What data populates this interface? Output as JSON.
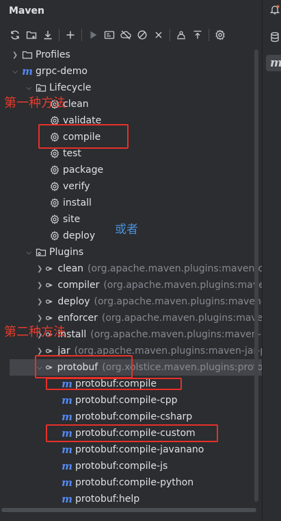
{
  "header": {
    "title": "Maven"
  },
  "toolbar": {
    "buttons": [
      {
        "icon": "refresh-icon"
      },
      {
        "icon": "add-folder-icon"
      },
      {
        "icon": "download-icon"
      },
      {
        "icon": "plus-icon"
      },
      {
        "icon": "run-icon"
      },
      {
        "icon": "execute-goal-icon"
      },
      {
        "icon": "offline-icon"
      },
      {
        "icon": "skip-tests-icon"
      },
      {
        "icon": "collapse-icon"
      },
      {
        "icon": "dependency-icon"
      },
      {
        "icon": "expand-all-icon"
      },
      {
        "icon": "settings-icon"
      }
    ]
  },
  "tree": {
    "profiles": "Profiles",
    "project": "grpc-demo",
    "lifecycle": {
      "label": "Lifecycle",
      "items": [
        "clean",
        "validate",
        "compile",
        "test",
        "package",
        "verify",
        "install",
        "site",
        "deploy"
      ]
    },
    "plugins": {
      "label": "Plugins",
      "items": [
        {
          "name": "clean",
          "hint": "(org.apache.maven.plugins:maven-cle"
        },
        {
          "name": "compiler",
          "hint": "(org.apache.maven.plugins:maven"
        },
        {
          "name": "deploy",
          "hint": "(org.apache.maven.plugins:maven-d"
        },
        {
          "name": "enforcer",
          "hint": "(org.apache.maven.plugins:maven-"
        },
        {
          "name": "install",
          "hint": "(org.apache.maven.plugins:maven-in"
        },
        {
          "name": "jar",
          "hint": "(org.apache.maven.plugins:maven-jar-pl"
        },
        {
          "name": "protobuf",
          "hint": "(org.xolstice.maven.plugins:protob"
        }
      ]
    },
    "protobuf_goals": [
      "protobuf:compile",
      "protobuf:compile-cpp",
      "protobuf:compile-csharp",
      "protobuf:compile-custom",
      "protobuf:compile-javanano",
      "protobuf:compile-js",
      "protobuf:compile-python",
      "protobuf:help"
    ]
  },
  "annotations": {
    "method1": "第一种方法",
    "or": "或者",
    "method2": "第二种方法"
  },
  "colors": {
    "accent": "#548af7",
    "annotation_red": "#e83a2c",
    "annotation_blue": "#4a8fd9",
    "background": "#2b2d30",
    "selection": "#43454a"
  }
}
